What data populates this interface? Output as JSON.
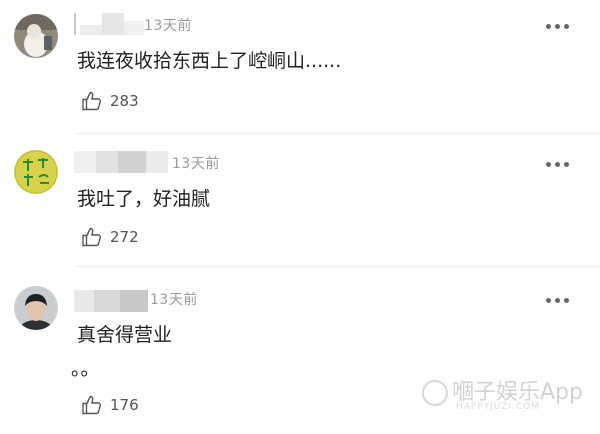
{
  "comments": [
    {
      "time": "13天前",
      "text": "我连夜收拾东西上了崆峒山......",
      "likes": "283"
    },
    {
      "time": "13天前",
      "text": "我吐了，好油腻",
      "likes": "272"
    },
    {
      "time": "13天前",
      "text": "真舍得营业",
      "text_line2": "。。",
      "likes": "176"
    }
  ],
  "watermark": {
    "text": "嗰子娱乐App",
    "sub": "HAPPYJUZI.COM"
  },
  "icons": {
    "more": "more-dots-icon",
    "like": "thumbs-up-icon"
  },
  "colors": {
    "text": "#222222",
    "meta": "#9b9b9b",
    "divider": "#ececec"
  }
}
